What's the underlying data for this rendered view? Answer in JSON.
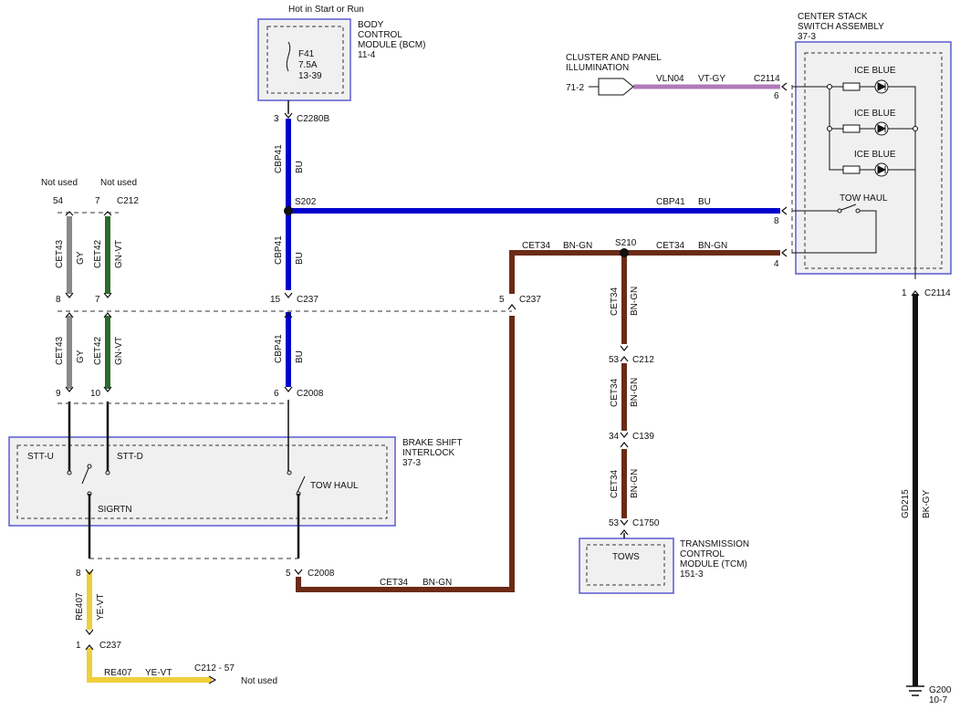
{
  "colors": {
    "blue": "#0000cc",
    "brown": "#6b2b17",
    "gray_wire": "#8a8a8a",
    "green_wire": "#2d6a2d",
    "yellow": "#f0cf3a",
    "black": "#111111",
    "violet": "#b07ab8",
    "module_border": "#5a5ad0",
    "module_fill": "#f0f0f0"
  },
  "bcm": {
    "hot_label": "Hot in Start or Run",
    "fuse_name": "F41",
    "fuse_rating": "7.5A",
    "fuse_ref": "13-39",
    "name_l1": "BODY",
    "name_l2": "CONTROL",
    "name_l3": "MODULE (BCM)",
    "page": "11-4"
  },
  "center_stack": {
    "name_l1": "CENTER STACK",
    "name_l2": "SWITCH ASSEMBLY",
    "page": "37-3",
    "led1": "ICE BLUE",
    "led2": "ICE BLUE",
    "led3": "ICE BLUE",
    "switch": "TOW HAUL"
  },
  "cluster": {
    "name_l1": "CLUSTER AND PANEL",
    "name_l2": "ILLUMINATION",
    "page": "71-2",
    "circuit": "VLN04",
    "color": "VT-GY",
    "connector": "C2114",
    "pin": "6"
  },
  "bsi": {
    "name_l1": "BRAKE SHIFT",
    "name_l2": "INTERLOCK",
    "page": "37-3",
    "stt_u": "STT-U",
    "stt_d": "STT-D",
    "sigrtn": "SIGRTN",
    "tow_haul": "TOW HAUL"
  },
  "tcm": {
    "name_l1": "TRANSMISSION",
    "name_l2": "CONTROL",
    "name_l3": "MODULE (TCM)",
    "page": "151-3",
    "pin_label": "TOWS"
  },
  "labels": {
    "not_used_1": "Not used",
    "not_used_2": "Not used",
    "not_used_3": "Not used",
    "c212_top": "C212",
    "pin_54": "54",
    "pin_7_top": "7",
    "pin_3": "3",
    "c2280b": "C2280B",
    "cbp41_a": "CBP41",
    "bu_a": "BU",
    "s202": "S202",
    "cbp41_h": "CBP41",
    "bu_h": "BU",
    "pin_8_right": "8",
    "s210": "S210",
    "cet34_l": "CET34",
    "bngn_l": "BN-GN",
    "cet34_r": "CET34",
    "bngn_r": "BN-GN",
    "pin_4_right": "4",
    "cet43_a": "CET43",
    "gy_a": "GY",
    "cet42_a": "CET42",
    "gnvt_a": "GN-VT",
    "cbp41_b": "CBP41",
    "bu_b": "BU",
    "pin_8_c237": "8",
    "pin_7_c237": "7",
    "pin_15": "15",
    "c237_a": "C237",
    "pin_5_c237": "5",
    "c237_b": "C237",
    "cet43_b": "CET43",
    "gy_b": "GY",
    "cet42_b": "CET42",
    "gnvt_b": "GN-VT",
    "cbp41_c": "CBP41",
    "bu_c": "BU",
    "pin_9": "9",
    "pin_10": "10",
    "pin_6": "6",
    "c2008_a": "C2008",
    "cet34_v1": "CET34",
    "bngn_v1": "BN-GN",
    "pin_53_c212": "53",
    "c212_mid": "C212",
    "cet34_v2": "CET34",
    "bngn_v2": "BN-GN",
    "pin_34": "34",
    "c139": "C139",
    "cet34_v3": "CET34",
    "bngn_v3": "BN-GN",
    "pin_53_c1750": "53",
    "c1750": "C1750",
    "pin_1_c2114": "1",
    "c2114_b": "C2114",
    "gd215": "GD215",
    "bkgy": "BK-GY",
    "g200": "G200",
    "g200_page": "10-7",
    "pin_8_bot": "8",
    "pin_5_bot": "5",
    "c2008_b": "C2008",
    "cet34_bot": "CET34",
    "bngn_bot": "BN-GN",
    "re407_v": "RE407",
    "yevt_v": "YE-VT",
    "pin_1_c237": "1",
    "c237_c": "C237",
    "re407_h": "RE407",
    "yevt_h": "YE-VT",
    "c212_57": "C212 - 57"
  }
}
